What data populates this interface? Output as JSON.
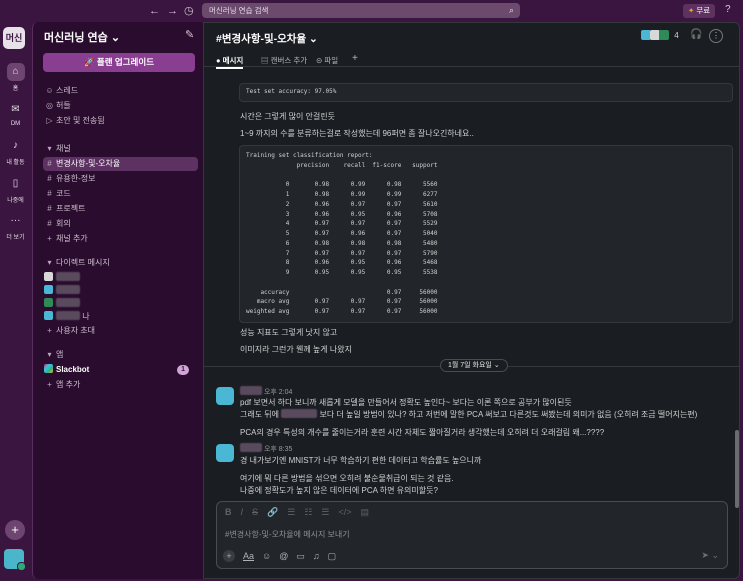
{
  "topbar": {
    "back": "←",
    "forward": "→",
    "history": "◷",
    "search_placeholder": "머신러닝 연습 검색",
    "upgrade_label": "무료",
    "help": "?"
  },
  "rail": {
    "workspace_abbr": "머신",
    "items": [
      {
        "label": "홈",
        "icon": "home-icon",
        "glyph": "⌂"
      },
      {
        "label": "DM",
        "icon": "dm-icon",
        "glyph": "✉"
      },
      {
        "label": "내 활동",
        "icon": "bell-icon",
        "glyph": "♪"
      },
      {
        "label": "나중에",
        "icon": "bookmark-icon",
        "glyph": "▯"
      },
      {
        "label": "더 보기",
        "icon": "more-icon",
        "glyph": "···"
      }
    ],
    "add": "+"
  },
  "sidebar": {
    "workspace_name": "머신러닝 연습",
    "chevron": "⌄",
    "compose": "✎",
    "plan_button": "🚀 플랜 업그레이드",
    "top_items": [
      {
        "icon": "☺",
        "label": "스레드"
      },
      {
        "icon": "◎",
        "label": "허들"
      },
      {
        "icon": "▷",
        "label": "초안 및 전송됨"
      }
    ],
    "channels_header": "채널",
    "channels": [
      {
        "label": "변경사항-및-오차율",
        "selected": true
      },
      {
        "label": "유용한-정보",
        "selected": false
      },
      {
        "label": "코드",
        "selected": false
      },
      {
        "label": "프로젝트",
        "selected": false
      },
      {
        "label": "회의",
        "selected": false
      }
    ],
    "add_channel": "채널 추가",
    "dm_header": "다이렉트 메시지",
    "dm_last_suffix": "나",
    "invite": "사용자 초대",
    "apps_header": "앱",
    "app_name": "Slackbot",
    "app_badge": "1",
    "add_app": "앱 추가"
  },
  "channel": {
    "title": "#변경사항-및-오차율",
    "member_count": "4",
    "tabs": [
      "메시지",
      "캔버스 추가",
      "파일"
    ],
    "tab_icons": [
      "●",
      "▤",
      "⊝"
    ],
    "tab_add": "+"
  },
  "messages": {
    "code1": "Test set accuracy: 97.05%",
    "line1": "시간은 그렇게 많이 안걸린듯",
    "line2": "1~9 까지의 수를 분류하는걸로 작성했는데 96퍼면 좀 잘나오긴하네요..",
    "code2": "Training set classification report:\n              precision    recall  f1-score   support\n\n           0       0.98      0.99      0.98      5560\n           1       0.98      0.99      0.99      6277\n           2       0.96      0.97      0.97      5610\n           3       0.96      0.95      0.96      5708\n           4       0.97      0.97      0.97      5529\n           5       0.97      0.96      0.97      5040\n           6       0.98      0.98      0.98      5480\n           7       0.97      0.97      0.97      5790\n           8       0.96      0.95      0.96      5468\n           9       0.95      0.95      0.95      5538\n\n    accuracy                           0.97     56000\n   macro avg       0.97      0.97      0.97     56000\nweighted avg       0.97      0.97      0.97     56000",
    "line3": "성능 지표도 그렇게 낫지 않고",
    "line4": "이미지라 그런가 웬께 높게 나왔지",
    "day_divider": "1월 7일 화요일 ⌄",
    "msg1_time": "오후 2:04",
    "msg1_l1": "pdf 보면서 하다 보니까 새롭게 모델을 만들어서 정확도 높인다~ 보다는 이론 쪽으로 공부가 많이된듯",
    "msg1_l2a": "그래도 뒤에",
    "msg1_l2b": "보다 더 높일 방법이 있나? 하고 저번에 말한 PCA 써보고 다른것도 써봤는데 의미가 없음 (오히려 조금 떨어지는편)",
    "msg1_l3": "PCA의 경우 특성의 개수를 줄이는거라 훈련 시간 자체도 짧아질거라 생각했는데 오히려 더 오래걸림 왜...????",
    "msg2_time": "오후 8:35",
    "msg2_l1": "경 내가보기엔 MNIST가 너무 학습하기 편한 데이터고 학습률도 높으니까",
    "msg2_l2": "여기에 뭐 다른 방법을 섞으면 오히려 불순물취급이 되는 것 같음.",
    "msg2_l3": "나중에 정확도가 높지 않은 데이터에 PCA 하면 유의미할듯?"
  },
  "composer": {
    "placeholder": "#변경사항-및-오차율에 메시지 보내기",
    "format_icons": [
      "B",
      "I",
      "S",
      "🔗",
      "☰",
      "☷",
      "☰",
      "</>",
      "▤"
    ],
    "bottom_icons": [
      "+",
      "Aa",
      "☺",
      "@",
      "▭",
      "♫",
      "▢"
    ],
    "send": "➤ ⌄"
  }
}
